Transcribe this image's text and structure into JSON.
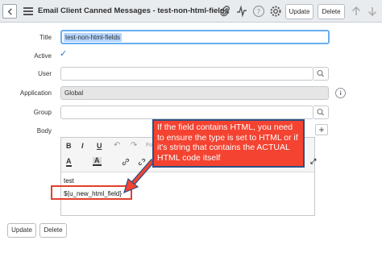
{
  "header": {
    "title": "Email Client Canned Messages - test-non-html-fields",
    "update_label": "Update",
    "delete_label": "Delete",
    "icons": [
      "back-icon",
      "hamburger-icon",
      "attachment-icon",
      "activity-icon",
      "help-icon",
      "settings-icon",
      "up-arrow-icon",
      "down-arrow-icon"
    ]
  },
  "form": {
    "title_label": "Title",
    "title_value": "test-non-html-fields",
    "active_label": "Active",
    "active_checked": true,
    "user_label": "User",
    "user_value": "",
    "application_label": "Application",
    "application_value": "Global",
    "group_label": "Group",
    "group_value": "",
    "body_label": "Body"
  },
  "editor": {
    "toolbar_row1": [
      "B",
      "I",
      "U",
      "↶",
      "↷",
      "Fo"
    ],
    "toolbar_row2": [
      "A",
      "A",
      "⤢"
    ],
    "lines": [
      "test",
      "${u_new_html_field}"
    ]
  },
  "callout": {
    "text": "If the field contains HTML, you need to ensure the type is set to HTML or if it's string that contains the ACTUAL HTML code itself",
    "color": "#f44331"
  },
  "footer": {
    "update_label": "Update",
    "delete_label": "Delete"
  }
}
